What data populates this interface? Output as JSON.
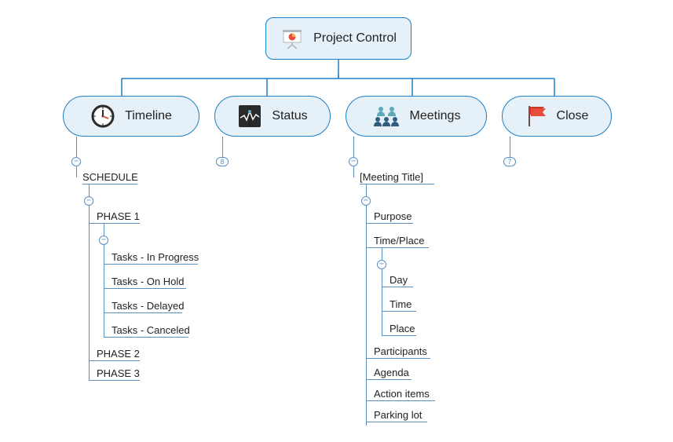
{
  "root": {
    "label": "Project Control",
    "icon": "presentation-icon"
  },
  "branches": {
    "timeline": {
      "label": "Timeline",
      "icon": "clock-icon"
    },
    "status": {
      "label": "Status",
      "icon": "heartbeat-icon",
      "badge": "8"
    },
    "meetings": {
      "label": "Meetings",
      "icon": "people-icon"
    },
    "close": {
      "label": "Close",
      "icon": "flag-icon",
      "badge": "7"
    }
  },
  "timeline_tree": {
    "schedule": "SCHEDULE",
    "phase1": "PHASE 1",
    "tasks": {
      "in_progress": "Tasks - In Progress",
      "on_hold": "Tasks - On Hold",
      "delayed": "Tasks - Delayed",
      "canceled": "Tasks - Canceled"
    },
    "phase2": "PHASE 2",
    "phase3": "PHASE 3"
  },
  "meetings_tree": {
    "title": "[Meeting Title]",
    "purpose": "Purpose",
    "time_place": "Time/Place",
    "tp_children": {
      "day": "Day",
      "time": "Time",
      "place": "Place"
    },
    "participants": "Participants",
    "agenda": "Agenda",
    "action_items": "Action items",
    "parking_lot": "Parking lot"
  },
  "toggle_collapsed": "−",
  "colors": {
    "border": "#1b7fc9",
    "fill": "#e5f0f9",
    "line": "#5a8fc2",
    "flag": "#e74c3c",
    "clock_hand": "#e74c3c",
    "people1": "#5fa8b8",
    "people2": "#2f5e80",
    "heartbeat_bg": "#2b2b2b"
  }
}
